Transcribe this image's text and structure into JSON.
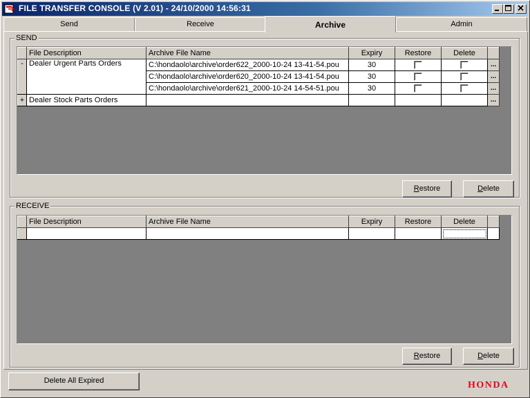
{
  "window": {
    "title": "FILE TRANSFER CONSOLE (V 2.01)  -  24/10/2000 14:56:31",
    "icon": "app-icon",
    "controls": [
      "minimize-icon",
      "maximize-icon",
      "close-icon"
    ]
  },
  "tabs": [
    {
      "label": "Send",
      "active": false
    },
    {
      "label": "Receive",
      "active": false
    },
    {
      "label": "Archive",
      "active": true
    },
    {
      "label": "Admin",
      "active": false
    }
  ],
  "send": {
    "group_label": "SEND",
    "columns": [
      "File Description",
      "Archive File Name",
      "Expiry",
      "Restore",
      "Delete"
    ],
    "groups": [
      {
        "toggle": "-",
        "description": "Dealer Urgent Parts Orders",
        "rows": [
          {
            "file": "C:\\hondaolo\\archive\\order622_2000-10-24 13-41-54.pou",
            "expiry": "30",
            "restore": false,
            "delete": false,
            "more": "..."
          },
          {
            "file": "C:\\hondaolo\\archive\\order620_2000-10-24 13-41-54.pou",
            "expiry": "30",
            "restore": false,
            "delete": false,
            "more": "..."
          },
          {
            "file": "C:\\hondaolo\\archive\\order621_2000-10-24 14-54-51.pou",
            "expiry": "30",
            "restore": false,
            "delete": false,
            "more": "..."
          }
        ]
      },
      {
        "toggle": "+",
        "description": "Dealer Stock Parts Orders",
        "more": "..."
      }
    ],
    "restore_button": {
      "accel": "R",
      "rest": "estore"
    },
    "delete_button": {
      "accel": "D",
      "rest": "elete"
    }
  },
  "receive": {
    "group_label": "RECEIVE",
    "columns": [
      "File Description",
      "Archive File Name",
      "Expiry",
      "Restore",
      "Delete"
    ],
    "restore_button": {
      "accel": "R",
      "rest": "estore"
    },
    "delete_button": {
      "accel": "D",
      "rest": "elete"
    }
  },
  "footer": {
    "delete_all_label": "Delete All Expired",
    "logo_text": "HONDA"
  },
  "colors": {
    "titlebar_start": "#0a246a",
    "titlebar_end": "#a6caf0",
    "face": "#d4d0c8",
    "grid_bg": "#808080",
    "brand_red": "#e8001a"
  }
}
